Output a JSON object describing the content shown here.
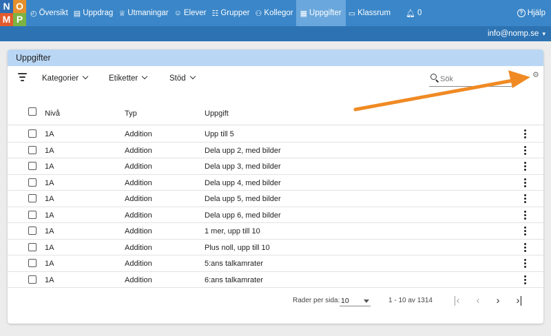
{
  "logo": {
    "letters": [
      "N",
      "O",
      "M",
      "P"
    ],
    "colors": [
      "#2e6db4",
      "#e5902d",
      "#e25b2e",
      "#7cb342"
    ]
  },
  "nav": {
    "items": [
      {
        "label": "Översikt",
        "icon": "dashboard-icon",
        "glyph": "◴"
      },
      {
        "label": "Uppdrag",
        "icon": "book-icon",
        "glyph": "▤"
      },
      {
        "label": "Utmaningar",
        "icon": "trophy-icon",
        "glyph": "♕"
      },
      {
        "label": "Elever",
        "icon": "user-icon",
        "glyph": "☺"
      },
      {
        "label": "Grupper",
        "icon": "users-icon",
        "glyph": "☷"
      },
      {
        "label": "Kollegor",
        "icon": "user-friends-icon",
        "glyph": "⚇"
      },
      {
        "label": "Uppgifter",
        "icon": "table-icon",
        "glyph": "▦",
        "active": true
      },
      {
        "label": "Klassrum",
        "icon": "chalkboard-icon",
        "glyph": "▭"
      },
      {
        "label": "0",
        "icon": "bell-icon",
        "glyph": "🔔︎"
      }
    ],
    "help_label": "Hjälp",
    "help_glyph": "?"
  },
  "account": {
    "email": "info@nomp.se",
    "caret": "▾"
  },
  "card": {
    "title": "Uppgifter"
  },
  "toolbar": {
    "filters": [
      "Kategorier",
      "Etiketter",
      "Stöd"
    ],
    "search_placeholder": "Sök",
    "settings_icon": "⚙"
  },
  "table": {
    "headers": {
      "level": "Nivå",
      "type": "Typ",
      "task": "Uppgift"
    },
    "rows": [
      {
        "level": "1A",
        "type": "Addition",
        "task": "Upp till 5"
      },
      {
        "level": "1A",
        "type": "Addition",
        "task": "Dela upp 2, med bilder"
      },
      {
        "level": "1A",
        "type": "Addition",
        "task": "Dela upp 3, med bilder"
      },
      {
        "level": "1A",
        "type": "Addition",
        "task": "Dela upp 4, med bilder"
      },
      {
        "level": "1A",
        "type": "Addition",
        "task": "Dela upp 5, med bilder"
      },
      {
        "level": "1A",
        "type": "Addition",
        "task": "Dela upp 6, med bilder"
      },
      {
        "level": "1A",
        "type": "Addition",
        "task": "1 mer, upp till 10"
      },
      {
        "level": "1A",
        "type": "Addition",
        "task": "Plus noll, upp till 10"
      },
      {
        "level": "1A",
        "type": "Addition",
        "task": "5:ans talkamrater"
      },
      {
        "level": "1A",
        "type": "Addition",
        "task": "6:ans talkamrater"
      }
    ]
  },
  "pagination": {
    "rows_per_page_label": "Rader per sida:",
    "rows_per_page_value": "10",
    "range_text": "1 - 10 av 1314",
    "first": "|‹",
    "prev": "‹",
    "next": "›",
    "last": "›|"
  },
  "annotation": {
    "arrow_color": "#f08a24"
  }
}
